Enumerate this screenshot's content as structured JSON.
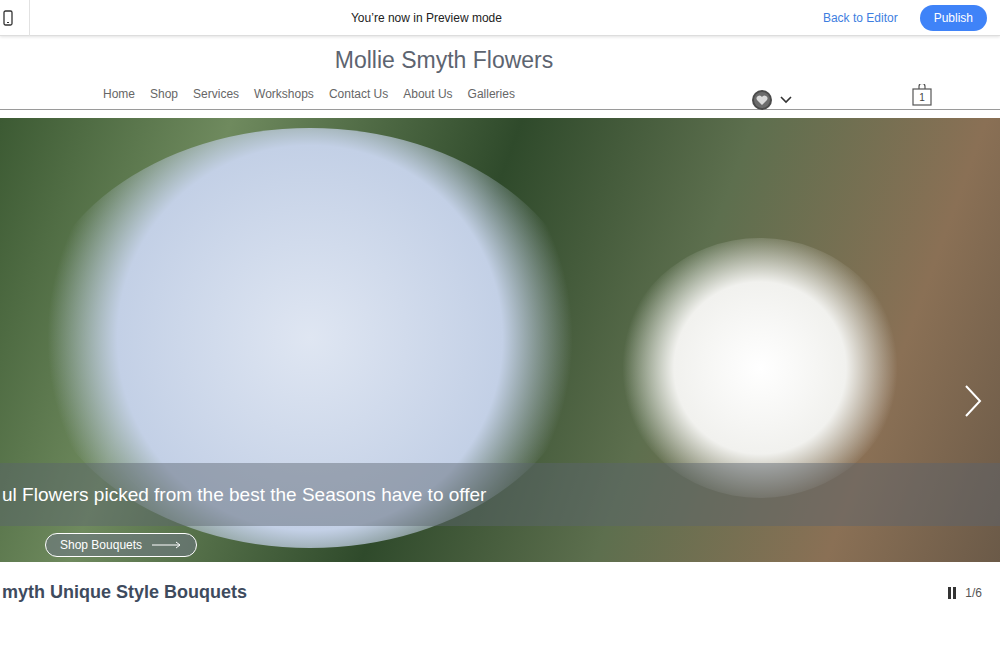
{
  "preview_bar": {
    "message": "You’re now in Preview mode",
    "back_link": "Back to Editor",
    "publish_button": "Publish"
  },
  "site": {
    "title": "Mollie Smyth Flowers"
  },
  "nav": [
    "Home",
    "Shop",
    "Services",
    "Workshops",
    "Contact Us",
    "About Us",
    "Galleries"
  ],
  "cart": {
    "count": "1"
  },
  "slideshow": {
    "caption": "ul Flowers picked from the best the Seasons have to offer",
    "button": "Shop Bouquets",
    "playing": true,
    "counter": "1/6"
  },
  "section_title": "myth Unique Style Bouquets"
}
